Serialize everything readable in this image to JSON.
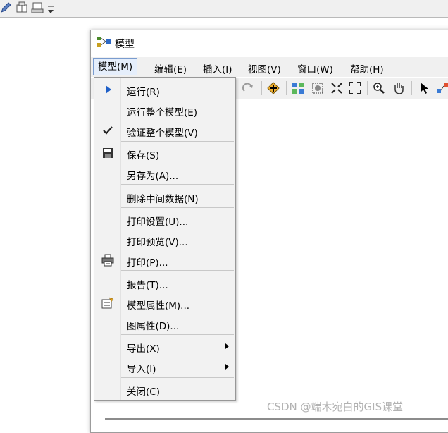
{
  "window": {
    "title": "模型"
  },
  "menu_bar": [
    {
      "label": "模型(M)"
    },
    {
      "label": "编辑(E)"
    },
    {
      "label": "插入(I)"
    },
    {
      "label": "视图(V)"
    },
    {
      "label": "窗口(W)"
    },
    {
      "label": "帮助(H)"
    }
  ],
  "dropdown": {
    "items": [
      {
        "label": "运行(R)",
        "icon": "run-triangle-icon"
      },
      {
        "label": "运行整个模型(E)"
      },
      {
        "label": "验证整个模型(V)",
        "icon": "checkmark-icon"
      },
      {
        "label": "保存(S)",
        "icon": "save-icon"
      },
      {
        "label": "另存为(A)..."
      },
      {
        "label": "删除中间数据(N)"
      },
      {
        "label": "打印设置(U)..."
      },
      {
        "label": "打印预览(V)..."
      },
      {
        "label": "打印(P)...",
        "icon": "printer-icon"
      },
      {
        "label": "报告(T)..."
      },
      {
        "label": "模型属性(M)...",
        "icon": "model-properties-icon"
      },
      {
        "label": "图属性(D)..."
      },
      {
        "label": "导出(X)",
        "submenu": true
      },
      {
        "label": "导入(I)",
        "submenu": true
      },
      {
        "label": "关闭(C)"
      }
    ]
  },
  "watermark": "CSDN @端木宛白的GIS课堂"
}
